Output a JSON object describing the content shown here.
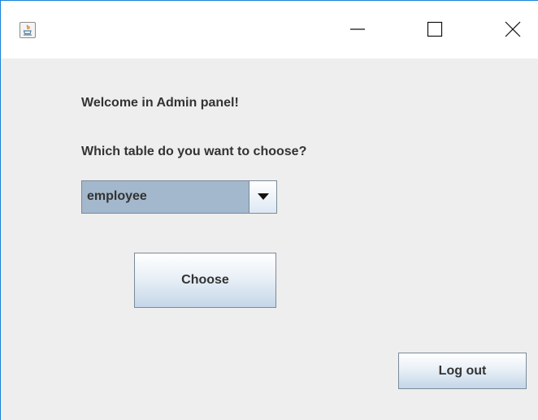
{
  "window": {
    "icon": "java-cup-icon",
    "controls": {
      "minimize": "minimize-icon",
      "maximize": "maximize-icon",
      "close": "close-icon"
    }
  },
  "panel": {
    "welcome_text": "Welcome in Admin panel!",
    "question_text": "Which table do you want to choose?",
    "table_select": {
      "selected": "employee"
    },
    "choose_label": "Choose",
    "logout_label": "Log out"
  },
  "colors": {
    "window_border": "#1883d7",
    "background": "#eeeeee",
    "combo_fill": "#a3b8cc",
    "text": "#333333"
  }
}
